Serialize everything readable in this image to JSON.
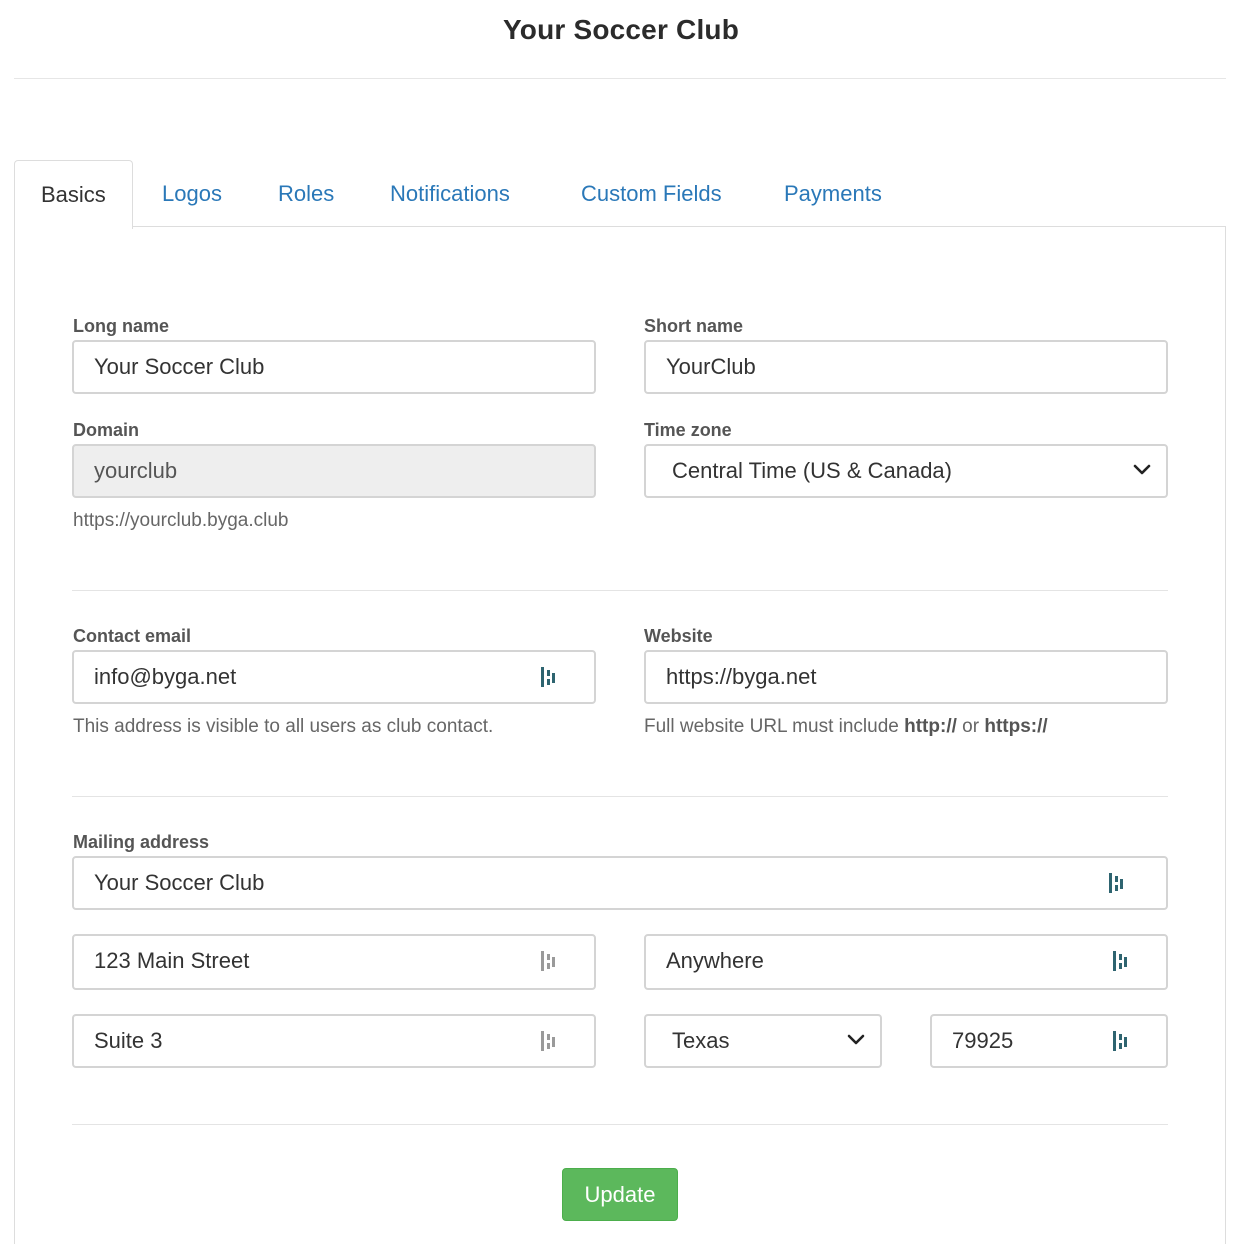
{
  "header": {
    "title": "Your Soccer Club"
  },
  "tabs": [
    {
      "label": "Basics",
      "active": true
    },
    {
      "label": "Logos",
      "active": false
    },
    {
      "label": "Roles",
      "active": false
    },
    {
      "label": "Notifications",
      "active": false
    },
    {
      "label": "Custom Fields",
      "active": false
    },
    {
      "label": "Payments",
      "active": false
    }
  ],
  "basics": {
    "long_name": {
      "label": "Long name",
      "value": "Your Soccer Club"
    },
    "short_name": {
      "label": "Short name",
      "value": "YourClub"
    },
    "domain": {
      "label": "Domain",
      "value": "yourclub",
      "help": "https://yourclub.byga.club"
    },
    "time_zone": {
      "label": "Time zone",
      "value": "Central Time (US & Canada)"
    }
  },
  "contact": {
    "email": {
      "label": "Contact email",
      "value": "info@byga.net",
      "help": "This address is visible to all users as club contact."
    },
    "website": {
      "label": "Website",
      "value": "https://byga.net",
      "help_prefix": "Full website URL must include ",
      "help_http": "http://",
      "help_or": " or ",
      "help_https": "https://"
    }
  },
  "mailing": {
    "label": "Mailing address",
    "line1": "Your Soccer Club",
    "line2": "123 Main Street",
    "city": "Anywhere",
    "line3": "Suite 3",
    "state": "Texas",
    "zip": "79925"
  },
  "actions": {
    "update_label": "Update"
  },
  "colors": {
    "link": "#2a78b8",
    "button": "#5cb85c",
    "password_icon": "#2e6470"
  }
}
